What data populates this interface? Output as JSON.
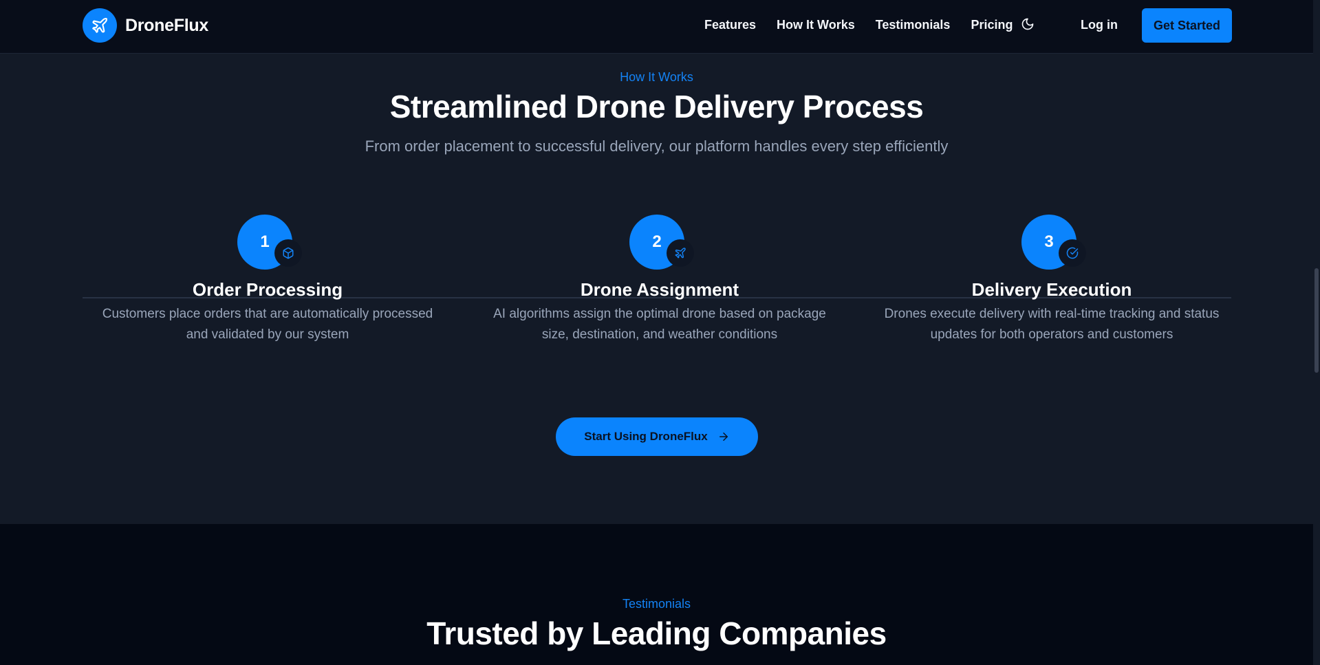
{
  "nav": {
    "brand": "DroneFlux",
    "links": [
      "Features",
      "How It Works",
      "Testimonials",
      "Pricing"
    ],
    "login": "Log in",
    "cta": "Get Started",
    "theme_icon": "moon-icon",
    "logo_icon": "plane-icon"
  },
  "how_it_works": {
    "eyebrow": "How It Works",
    "title": "Streamlined Drone Delivery Process",
    "subtitle": "From order placement to successful delivery, our platform handles every step efficiently",
    "steps": [
      {
        "number": "1",
        "icon": "package-icon",
        "title": "Order Processing",
        "description": "Customers place orders that are automatically processed and validated by our system"
      },
      {
        "number": "2",
        "icon": "plane-icon",
        "title": "Drone Assignment",
        "description": "AI algorithms assign the optimal drone based on package size, destination, and weather conditions"
      },
      {
        "number": "3",
        "icon": "check-circle-icon",
        "title": "Delivery Execution",
        "description": "Drones execute delivery with real-time tracking and status updates for both operators and customers"
      }
    ],
    "cta": "Start Using DroneFlux",
    "cta_icon": "arrow-right-icon"
  },
  "testimonials": {
    "eyebrow": "Testimonials",
    "title": "Trusted by Leading Companies"
  },
  "colors": {
    "accent": "#0b84fd",
    "nav_bg": "#080d19",
    "section_bg": "#131a27",
    "section_dark_bg": "#040914",
    "muted_text": "#9aa6ba"
  }
}
